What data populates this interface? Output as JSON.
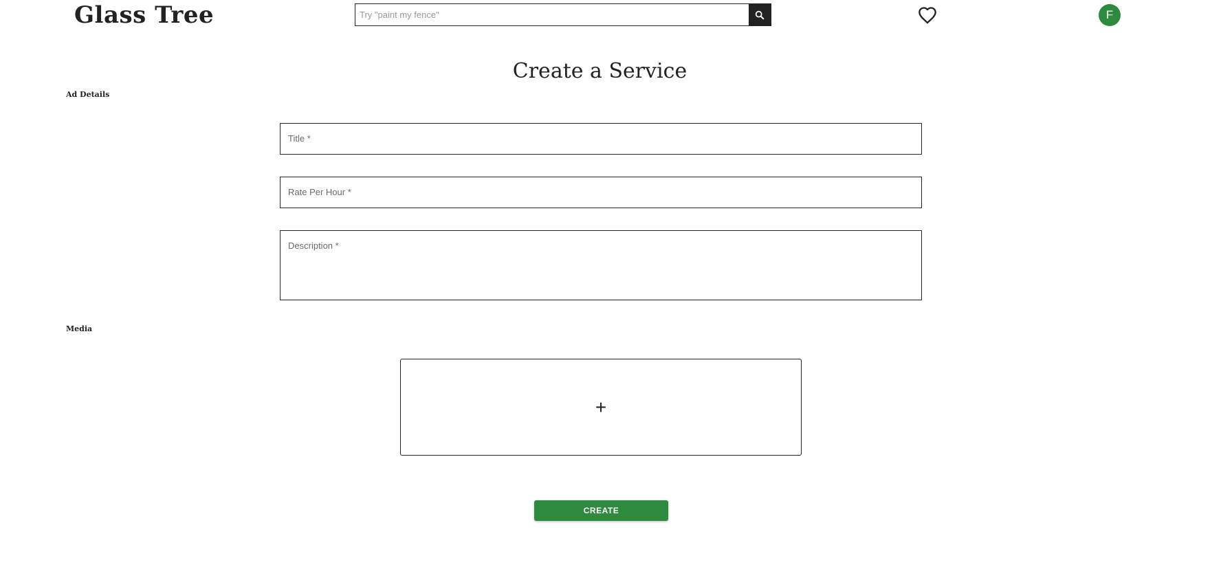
{
  "header": {
    "logo": "Glass Tree",
    "search": {
      "placeholder": "Try \"paint my fence\"",
      "value": ""
    },
    "avatar_initial": "F"
  },
  "icons": {
    "search": "search-icon",
    "favorites": "heart-icon",
    "upload": "plus-icon"
  },
  "main": {
    "title": "Create a Service",
    "ad_details_label": "Ad Details",
    "fields": {
      "title": "Title *",
      "rate": "Rate Per Hour *",
      "description": "Description *"
    },
    "media_label": "Media",
    "upload_symbol": "+",
    "create_label": "CREATE"
  },
  "colors": {
    "accent": "#2d8a3e",
    "text": "#222222",
    "search_button": "#222222"
  }
}
